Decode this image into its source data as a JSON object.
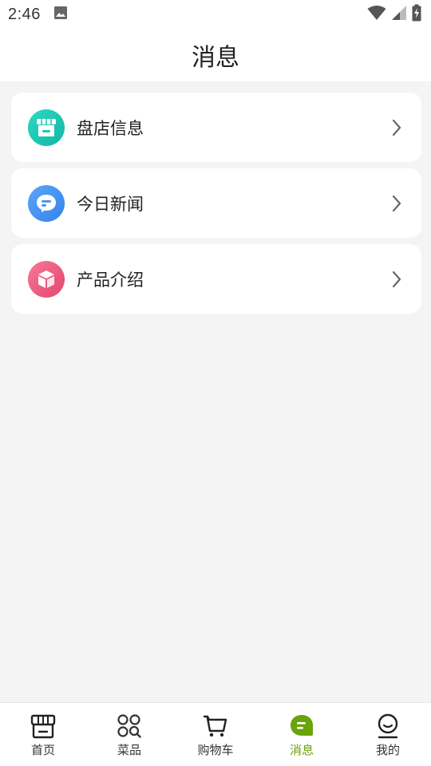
{
  "status_bar": {
    "time": "2:46",
    "icons": [
      "image-icon",
      "wifi-icon",
      "signal-icon",
      "battery-charging-icon"
    ]
  },
  "header": {
    "title": "消息"
  },
  "menu": {
    "items": [
      {
        "label": "盘店信息",
        "icon": "store-icon",
        "color": "#1fc6b3"
      },
      {
        "label": "今日新闻",
        "icon": "chat-bubble-icon",
        "color": "#3f8ff0"
      },
      {
        "label": "产品介绍",
        "icon": "box-icon",
        "color": "#ee5478"
      }
    ]
  },
  "tabbar": {
    "active_color": "#6aa30a",
    "items": [
      {
        "label": "首页",
        "icon": "home-icon",
        "active": false
      },
      {
        "label": "菜品",
        "icon": "dishes-icon",
        "active": false
      },
      {
        "label": "购物车",
        "icon": "cart-icon",
        "active": false
      },
      {
        "label": "消息",
        "icon": "message-icon",
        "active": true
      },
      {
        "label": "我的",
        "icon": "profile-icon",
        "active": false
      }
    ]
  }
}
